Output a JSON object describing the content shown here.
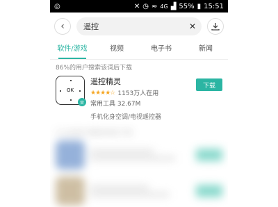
{
  "status_bar": {
    "left_icon": "notification-icon",
    "network": "4G",
    "battery": "55%",
    "time": "15:51"
  },
  "search": {
    "query": "遥控"
  },
  "tabs": [
    {
      "label": "软件/游戏"
    },
    {
      "label": "视频"
    },
    {
      "label": "电子书"
    },
    {
      "label": "新闻"
    }
  ],
  "section_hint": "86%的用户搜索该词后下载",
  "app": {
    "icon_text": "OK",
    "name": "遥控精灵",
    "stars": "★★★★☆",
    "installs": "1153万人在用",
    "category_size": "常用工具  32.67M",
    "description": "手机化身空调/电视遥控器",
    "button_label": "下载"
  },
  "blurred_section_hint": "51%的用户搜索该词后下载",
  "colors": {
    "accent": "#2bb5a3",
    "status_bar": "#000000"
  }
}
